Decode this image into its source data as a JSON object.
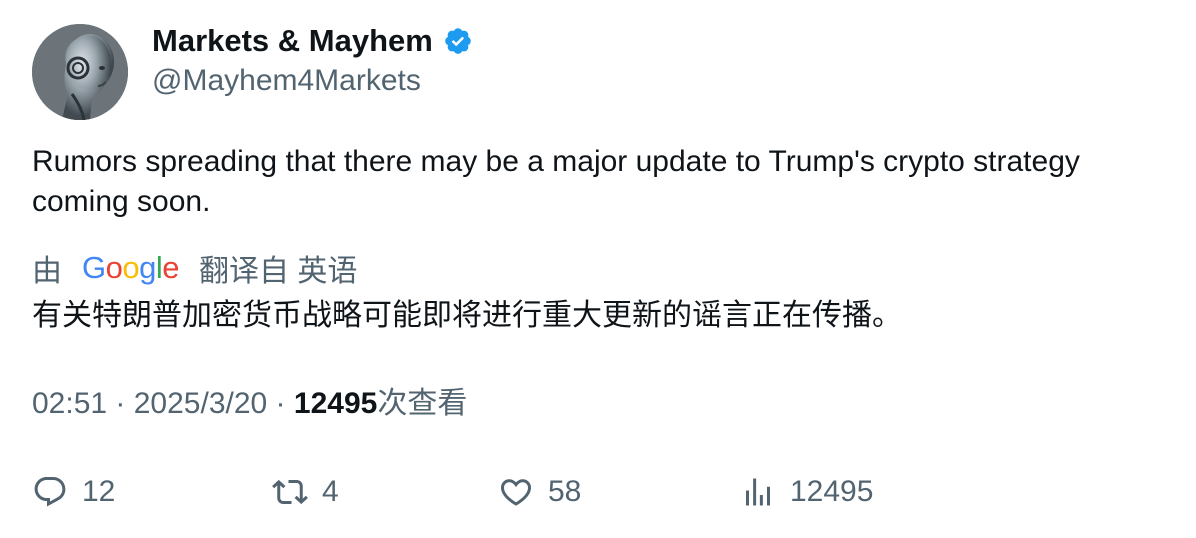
{
  "author": {
    "name": "Markets & Mayhem",
    "handle": "@Mayhem4Markets",
    "verified": true
  },
  "tweet": {
    "text": "Rumors spreading that there may be a major update to Trump's crypto strategy coming soon."
  },
  "translation": {
    "by_label": "由",
    "provider": "Google",
    "from_label": "翻译自 英语",
    "text": "有关特朗普加密货币战略可能即将进行重大更新的谣言正在传播。"
  },
  "meta": {
    "time": "02:51",
    "date": "2025/3/20",
    "views_count": "12495",
    "views_label": "次查看"
  },
  "actions": {
    "replies": "12",
    "retweets": "4",
    "likes": "58",
    "views": "12495"
  },
  "colors": {
    "verified": "#1d9bf0",
    "secondary_text": "#536471",
    "google_blue": "#4285F4",
    "google_red": "#EA4335",
    "google_yellow": "#FBBC05",
    "google_green": "#34A853"
  }
}
